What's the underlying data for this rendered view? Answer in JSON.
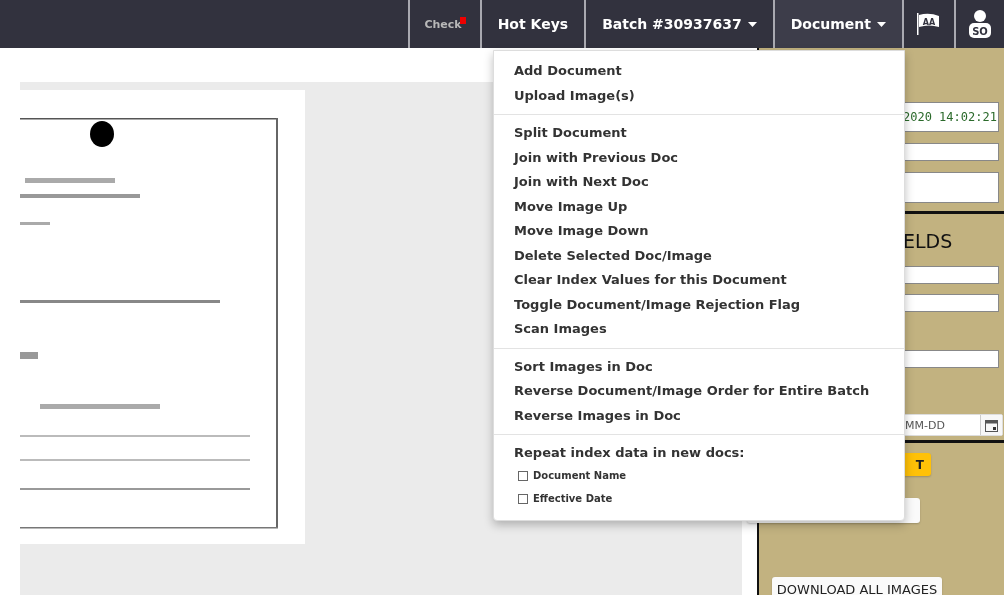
{
  "navbar": {
    "items": [
      {
        "kind": "check",
        "label": "Check"
      },
      {
        "kind": "link",
        "label": "Hot Keys"
      },
      {
        "kind": "dropdown",
        "label": "Batch #30937637",
        "expanded": false
      },
      {
        "kind": "dropdown",
        "label": "Document",
        "expanded": true
      },
      {
        "kind": "flag",
        "label": "AA"
      },
      {
        "kind": "user",
        "label": "SO"
      }
    ]
  },
  "document_menu": {
    "sections": [
      {
        "items": [
          "Add Document",
          "Upload Image(s)"
        ]
      },
      {
        "items": [
          "Split Document",
          "Join with Previous Doc",
          "Join with Next Doc",
          "Move Image Up",
          "Move Image Down",
          "Delete Selected Doc/Image",
          "Clear Index Values for this Document",
          "Toggle Document/Image Rejection Flag",
          "Scan Images"
        ]
      },
      {
        "items": [
          "Sort Images in Doc",
          "Reverse Document/Image Order for Entire Batch",
          "Reverse Images in Doc"
        ]
      }
    ],
    "repeat": {
      "heading": "Repeat index data in new docs:",
      "options": [
        {
          "label": "Document Name",
          "checked": false
        },
        {
          "label": "Effective Date",
          "checked": false
        }
      ]
    }
  },
  "panel": {
    "top_fields": [
      {
        "kind": "text",
        "value": "2020 14:02:21"
      },
      {
        "kind": "text"
      },
      {
        "kind": "textarea"
      }
    ],
    "heading": "ELDS",
    "fields": [
      {
        "kind": "text"
      },
      {
        "kind": "text"
      },
      {
        "kind": "text"
      },
      {
        "kind": "date",
        "placeholder": "MM-DD"
      }
    ],
    "buttons": [
      {
        "kind": "primary",
        "label": "T"
      },
      {
        "kind": "plain"
      },
      {
        "kind": "plain",
        "label": "DOWNLOAD ALL IMAGES"
      }
    ]
  }
}
